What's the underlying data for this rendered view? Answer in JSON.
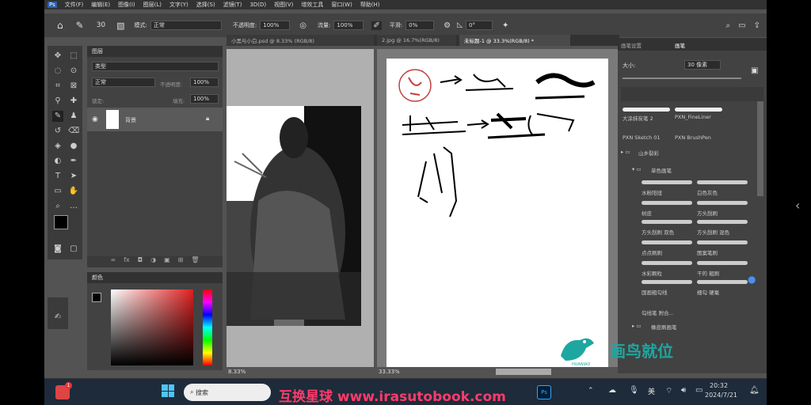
{
  "menubar": {
    "items": [
      "文件(F)",
      "编辑(E)",
      "图像(I)",
      "图层(L)",
      "文字(Y)",
      "选择(S)",
      "滤镜(T)",
      "3D(D)",
      "视图(V)",
      "增效工具",
      "窗口(W)",
      "帮助(H)"
    ]
  },
  "options": {
    "mode_label": "模式:",
    "mode_value": "正常",
    "opacity_label": "不透明度:",
    "opacity_value": "100%",
    "flow_label": "流量:",
    "flow_value": "100%",
    "smooth_label": "平滑:",
    "smooth_value": "0%",
    "angle_value": "0°",
    "brush_size": "30"
  },
  "tabs": [
    {
      "label": "小黑与小白.psd @ 8.33% (RGB/8)"
    },
    {
      "label": "2.jpg @ 16.7%(RGB/8)"
    },
    {
      "label": "未标题-1 @ 33.3%(RGB/8) *"
    }
  ],
  "layers": {
    "title": "图层",
    "search_placeholder": "类型",
    "blend": "正常",
    "opacity_label": "不透明度:",
    "opacity": "100%",
    "lock_label": "锁定:",
    "fill_label": "填充:",
    "fill": "100%",
    "layer_name": "背景"
  },
  "color": {
    "title": "颜色"
  },
  "brushes": {
    "tab1": "画笔设置",
    "tab2": "画笔",
    "size_label": "大小:",
    "size_value": "30 像素",
    "row1": [
      "大涂抹炭笔 2",
      "PXN_FineLiner"
    ],
    "row2": [
      "PXN Sketch 01",
      "PXN BrushPen"
    ],
    "group1": "山乡裂彩",
    "group2": "单色画笔",
    "items": [
      "水粉阳扭",
      "白色灰色",
      "树皮",
      "方头刮刷",
      "方头刮刷 双色",
      "方头刮刷 混色",
      "点点刷刷",
      "图案笔刷",
      "水彩颗粒",
      "干的 粗刷",
      "国画粗勾线",
      "细勾 硬毫",
      "勾线笔 附合..."
    ],
    "group3": "橡皮刷画笔"
  },
  "status": {
    "left_zoom": "8.33%",
    "right_zoom": "33.33%"
  },
  "watermark": {
    "brand": "画鸟就位",
    "site": "互换星球 www.irasutobook.com",
    "sub": "HUANIAO"
  },
  "taskbar": {
    "search": "搜索",
    "ime": "美",
    "time": "20:32",
    "date": "2024/7/21",
    "badge": "1"
  }
}
